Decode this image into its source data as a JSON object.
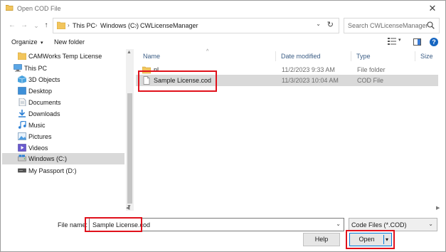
{
  "window": {
    "title": "Open COD File"
  },
  "nav": {
    "back": "←",
    "forward": "→",
    "recent": "⌄",
    "up": "↑"
  },
  "address": {
    "crumbs": [
      "This PC",
      "Windows (C:)",
      "CWLicenseManager"
    ],
    "separator": "›",
    "dropdown": "⌄",
    "refresh": "↻"
  },
  "search": {
    "placeholder": "Search CWLicenseManager"
  },
  "toolbar": {
    "organize": "Organize",
    "organize_arrow": "▾",
    "new_folder": "New folder",
    "view_arrow": "▾"
  },
  "sidebar": {
    "items": [
      {
        "label": "CAMWorks Temp License",
        "icon": "folder-icon"
      },
      {
        "label": "This PC",
        "icon": "computer-icon"
      },
      {
        "label": "3D Objects",
        "icon": "3d-objects-icon"
      },
      {
        "label": "Desktop",
        "icon": "desktop-icon"
      },
      {
        "label": "Documents",
        "icon": "documents-icon"
      },
      {
        "label": "Downloads",
        "icon": "downloads-icon"
      },
      {
        "label": "Music",
        "icon": "music-icon"
      },
      {
        "label": "Pictures",
        "icon": "pictures-icon"
      },
      {
        "label": "Videos",
        "icon": "videos-icon"
      },
      {
        "label": "Windows (C:)",
        "icon": "drive-icon"
      },
      {
        "label": "My Passport (D:)",
        "icon": "usb-drive-icon"
      }
    ],
    "selected": "Windows (C:)"
  },
  "columns": {
    "name": "Name",
    "date": "Date modified",
    "type": "Type",
    "size": "Size"
  },
  "files": [
    {
      "name": "nl",
      "date": "11/2/2023 9:33 AM",
      "type": "File folder",
      "icon": "folder-icon"
    },
    {
      "name": "Sample License.cod",
      "date": "11/3/2023 10:04 AM",
      "type": "COD File",
      "icon": "file-icon"
    }
  ],
  "bottom": {
    "filename_label": "File name:",
    "filename_value": "Sample License.cod",
    "filetype_value": "Code Files (*.COD)",
    "help_label": "Help",
    "open_label": "Open"
  },
  "colors": {
    "highlight": "#e0111b",
    "accent": "#0078d7",
    "selection": "#d9d9d9",
    "folder": "#f2c55c"
  }
}
